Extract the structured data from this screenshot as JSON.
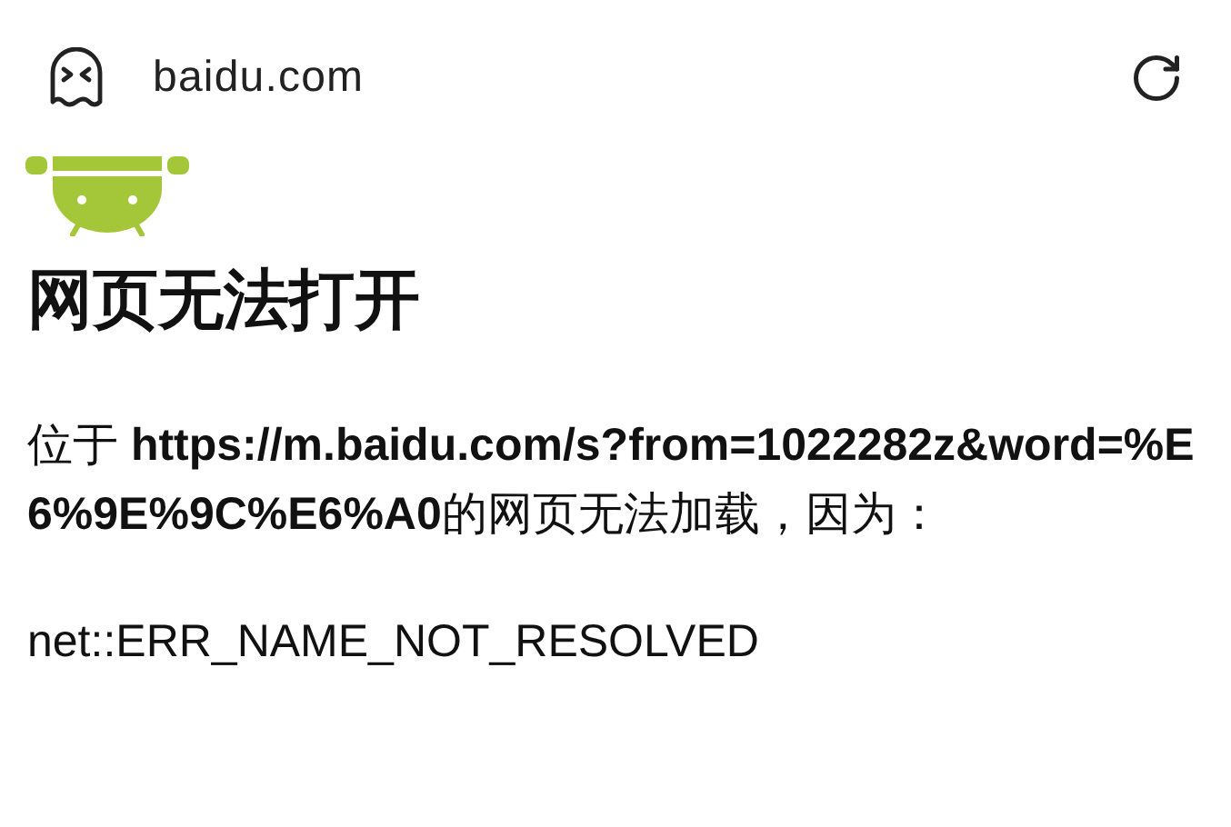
{
  "address_bar": {
    "domain": "baidu.com"
  },
  "error": {
    "title": "网页无法打开",
    "message": "位于 **https://m.baidu.com/s?from=1022282z&word=%E6%9E%9C%E6%A0**的网页无法加载，因为：",
    "code": "net::ERR_NAME_NOT_RESOLVED"
  }
}
